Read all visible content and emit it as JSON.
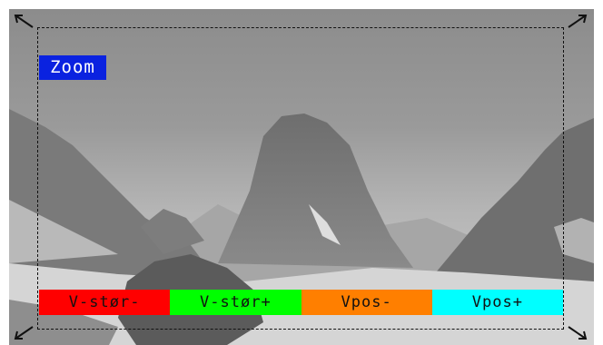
{
  "overlay": {
    "mode_label": "Zoom"
  },
  "softkeys": [
    {
      "label": "V-stør-",
      "color": "#ff0000"
    },
    {
      "label": "V-stør+",
      "color": "#00ff00"
    },
    {
      "label": "Vpos-",
      "color": "#ff7f00"
    },
    {
      "label": "Vpos+",
      "color": "#00ffff"
    }
  ],
  "icons": {
    "corners": [
      "resize-arrow-top-left-icon",
      "resize-arrow-top-right-icon",
      "resize-arrow-bottom-left-icon",
      "resize-arrow-bottom-right-icon"
    ]
  }
}
